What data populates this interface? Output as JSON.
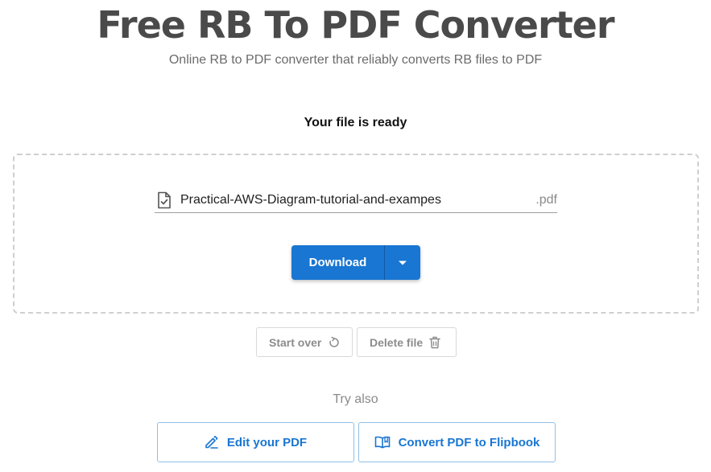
{
  "header": {
    "title": "Free RB To PDF Converter",
    "subtitle": "Online RB to PDF converter that reliably converts RB files to PDF"
  },
  "status": {
    "ready_text": "Your file is ready"
  },
  "file": {
    "name": "Practical-AWS-Diagram-tutorial-and-exampes",
    "extension": ".pdf",
    "icon": "file-check-icon"
  },
  "actions": {
    "download_label": "Download",
    "dropdown_icon": "caret-down-icon",
    "start_over_label": "Start over",
    "start_over_icon": "refresh-icon",
    "delete_label": "Delete file",
    "delete_icon": "trash-icon"
  },
  "try_also": {
    "heading": "Try also",
    "items": [
      {
        "label": "Edit your PDF",
        "icon": "pen-icon"
      },
      {
        "label": "Convert PDF to Flipbook",
        "icon": "book-icon"
      }
    ]
  },
  "colors": {
    "accent": "#1976d2",
    "title": "#4a4a4a",
    "muted": "#8c8c8c",
    "outline": "#90bfe9"
  }
}
